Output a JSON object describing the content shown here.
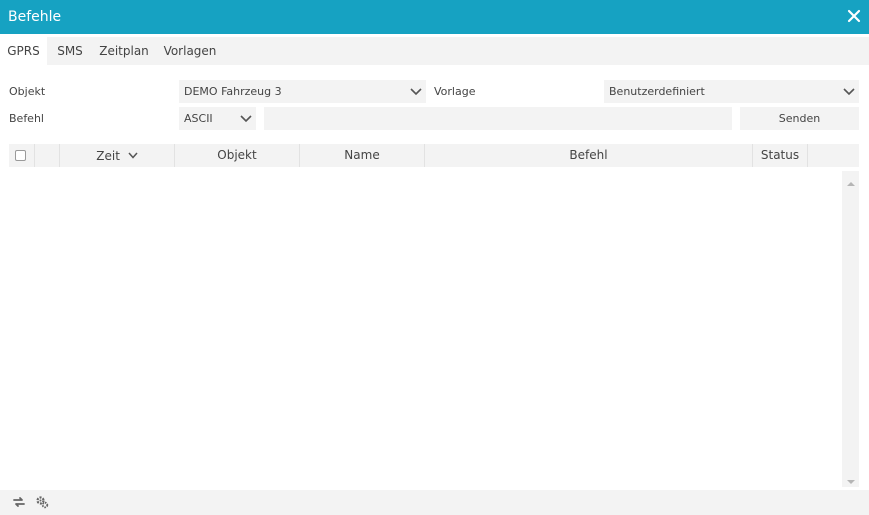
{
  "window": {
    "title": "Befehle",
    "close_icon": "close-icon"
  },
  "tabs": [
    {
      "label": "GPRS",
      "active": true
    },
    {
      "label": "SMS",
      "active": false
    },
    {
      "label": "Zeitplan",
      "active": false
    },
    {
      "label": "Vorlagen",
      "active": false
    }
  ],
  "form": {
    "objekt_label": "Objekt",
    "objekt_value": "DEMO Fahrzeug 3",
    "vorlage_label": "Vorlage",
    "vorlage_value": "Benutzerdefiniert",
    "befehl_label": "Befehl",
    "encoding_value": "ASCII",
    "command_value": "",
    "send_label": "Senden"
  },
  "table": {
    "columns": [
      {
        "key": "select",
        "label": ""
      },
      {
        "key": "blank",
        "label": ""
      },
      {
        "key": "zeit",
        "label": "Zeit",
        "sort": "desc"
      },
      {
        "key": "objekt",
        "label": "Objekt"
      },
      {
        "key": "name",
        "label": "Name"
      },
      {
        "key": "befehl",
        "label": "Befehl"
      },
      {
        "key": "status",
        "label": "Status"
      }
    ],
    "rows": []
  },
  "footer": {
    "icons": [
      "refresh-icon",
      "settings-icon"
    ]
  },
  "colors": {
    "accent": "#16a2c2",
    "panel": "#f3f3f3",
    "text": "#444444"
  }
}
